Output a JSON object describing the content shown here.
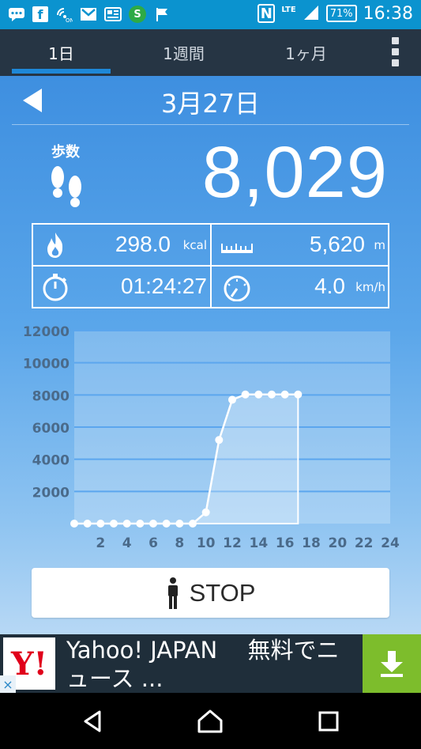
{
  "status_bar": {
    "icons": [
      "chat-icon",
      "facebook-icon",
      "voicemail-icon",
      "gmail-icon",
      "news-icon",
      "s-app-icon",
      "flag-icon"
    ],
    "nfc": "N",
    "network": "LTE",
    "battery": "71%",
    "time": "16:38"
  },
  "tabs": [
    {
      "label": "1日",
      "active": true
    },
    {
      "label": "1週間",
      "active": false
    },
    {
      "label": "1ヶ月",
      "active": false
    }
  ],
  "date": "3月27日",
  "steps": {
    "label": "歩数",
    "value": "8,029"
  },
  "stats": {
    "calories": {
      "value": "298.0",
      "unit": "kcal",
      "icon": "flame-icon"
    },
    "distance": {
      "value": "5,620",
      "unit": "m",
      "icon": "ruler-icon"
    },
    "time": {
      "value": "01:24:27",
      "icon": "stopwatch-icon"
    },
    "speed": {
      "value": "4.0",
      "unit": "km/h",
      "icon": "speedometer-icon"
    }
  },
  "chart_data": {
    "type": "area",
    "x_ticks": [
      2,
      4,
      6,
      8,
      10,
      12,
      14,
      16,
      18,
      20,
      22,
      24
    ],
    "y_ticks": [
      2000,
      4000,
      6000,
      8000,
      10000,
      12000
    ],
    "xlim": [
      0,
      24
    ],
    "ylim": [
      0,
      12000
    ],
    "x": [
      0,
      1,
      2,
      3,
      4,
      5,
      6,
      7,
      8,
      9,
      10,
      11,
      12,
      13,
      14,
      15,
      16,
      17
    ],
    "values": [
      0,
      0,
      0,
      0,
      0,
      0,
      0,
      0,
      0,
      0,
      700,
      5200,
      7700,
      8029,
      8029,
      8029,
      8029,
      8029
    ],
    "grid": true
  },
  "stop_button": {
    "label": "STOP"
  },
  "ad": {
    "text": "Yahoo! JAPAN　 無料でニュース ...",
    "logo": "Y!",
    "close": "×"
  }
}
